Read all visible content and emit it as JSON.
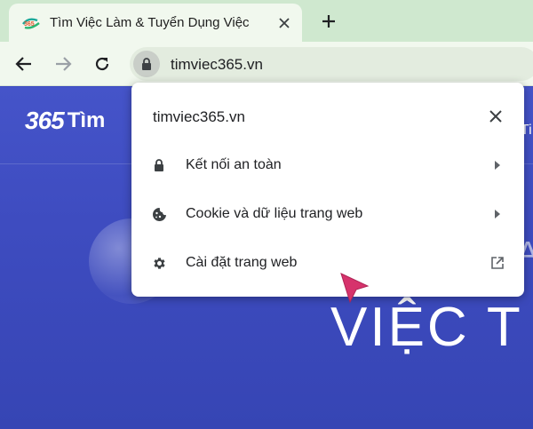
{
  "colors": {
    "tabstrip": "#cfe8cf",
    "toolbar": "#f1f8ee",
    "page_bg": "#3e4cc0",
    "cursor": "#d6336c"
  },
  "tab": {
    "favicon": "timviec365-favicon",
    "favicon_text": "365",
    "title": "Tìm Việc Làm & Tuyển Dụng Việc",
    "close_icon": "close-icon"
  },
  "toolbar": {
    "back_icon": "arrow-left-icon",
    "forward_icon": "arrow-right-icon",
    "reload_icon": "reload-icon",
    "url": "timviec365.vn",
    "lock_icon": "lock-icon"
  },
  "popup": {
    "title": "timviec365.vn",
    "items": [
      {
        "label": "Kết nối an toàn",
        "icon": "lock-icon",
        "trail": "chevron-right-icon"
      },
      {
        "label": "Cookie và dữ liệu trang web",
        "icon": "cookie-icon",
        "trail": "chevron-right-icon"
      },
      {
        "label": "Cài đặt trang web",
        "icon": "gear-icon",
        "trail": "open-external-icon"
      }
    ]
  },
  "page": {
    "logo_number": "365",
    "logo_text": "Tìm",
    "heading": "VIỆC T",
    "fragment_a": "A",
    "fragment_ti": "Ti"
  }
}
